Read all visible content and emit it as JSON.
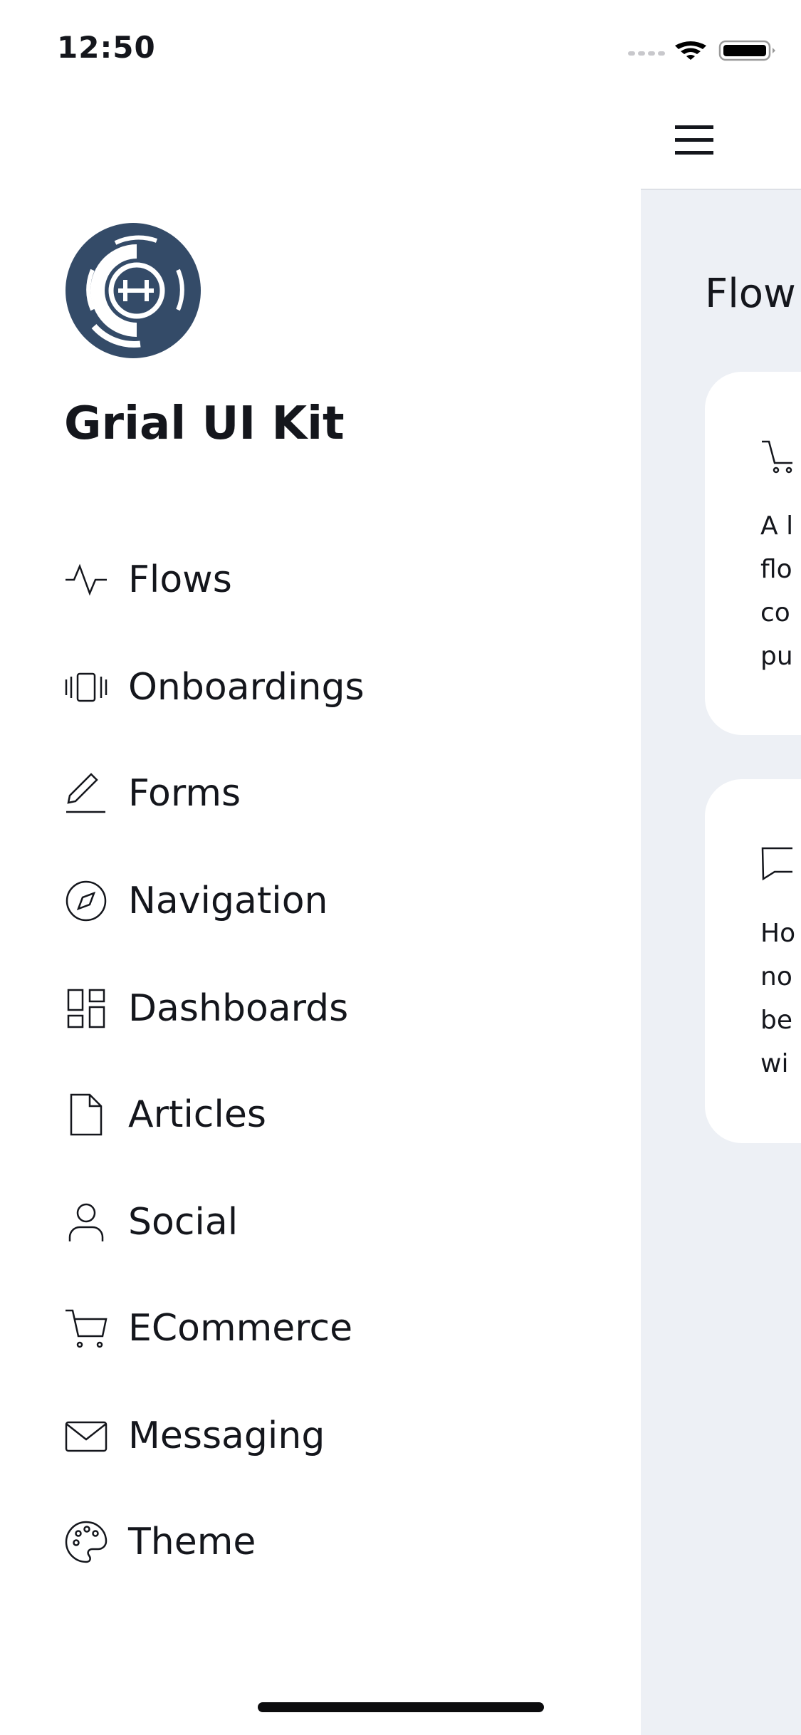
{
  "status_bar": {
    "time": "12:50",
    "icons": [
      "signal-icon",
      "wifi-icon",
      "battery-icon"
    ]
  },
  "header": {
    "menu_icon": "hamburger-icon"
  },
  "drawer": {
    "logo": "grial-logo",
    "title": "Grial UI Kit",
    "items": [
      {
        "label": "Flows",
        "icon": "activity-icon"
      },
      {
        "label": "Onboardings",
        "icon": "carousel-icon"
      },
      {
        "label": "Forms",
        "icon": "edit-icon"
      },
      {
        "label": "Navigation",
        "icon": "compass-icon"
      },
      {
        "label": "Dashboards",
        "icon": "dashboard-icon"
      },
      {
        "label": "Articles",
        "icon": "file-icon"
      },
      {
        "label": "Social",
        "icon": "user-icon"
      },
      {
        "label": "ECommerce",
        "icon": "cart-icon"
      },
      {
        "label": "Messaging",
        "icon": "mail-icon"
      },
      {
        "label": "Theme",
        "icon": "palette-icon"
      }
    ]
  },
  "main": {
    "title": "Flow",
    "cards": [
      {
        "icon": "cart-icon",
        "text": "A l\nflo\nco\npu"
      },
      {
        "icon": "chat-icon",
        "text": "Ho\nno\nbe\nwi"
      }
    ]
  },
  "colors": {
    "logo": "#344b68",
    "panel_bg": "#edf0f5",
    "text": "#14161c"
  }
}
